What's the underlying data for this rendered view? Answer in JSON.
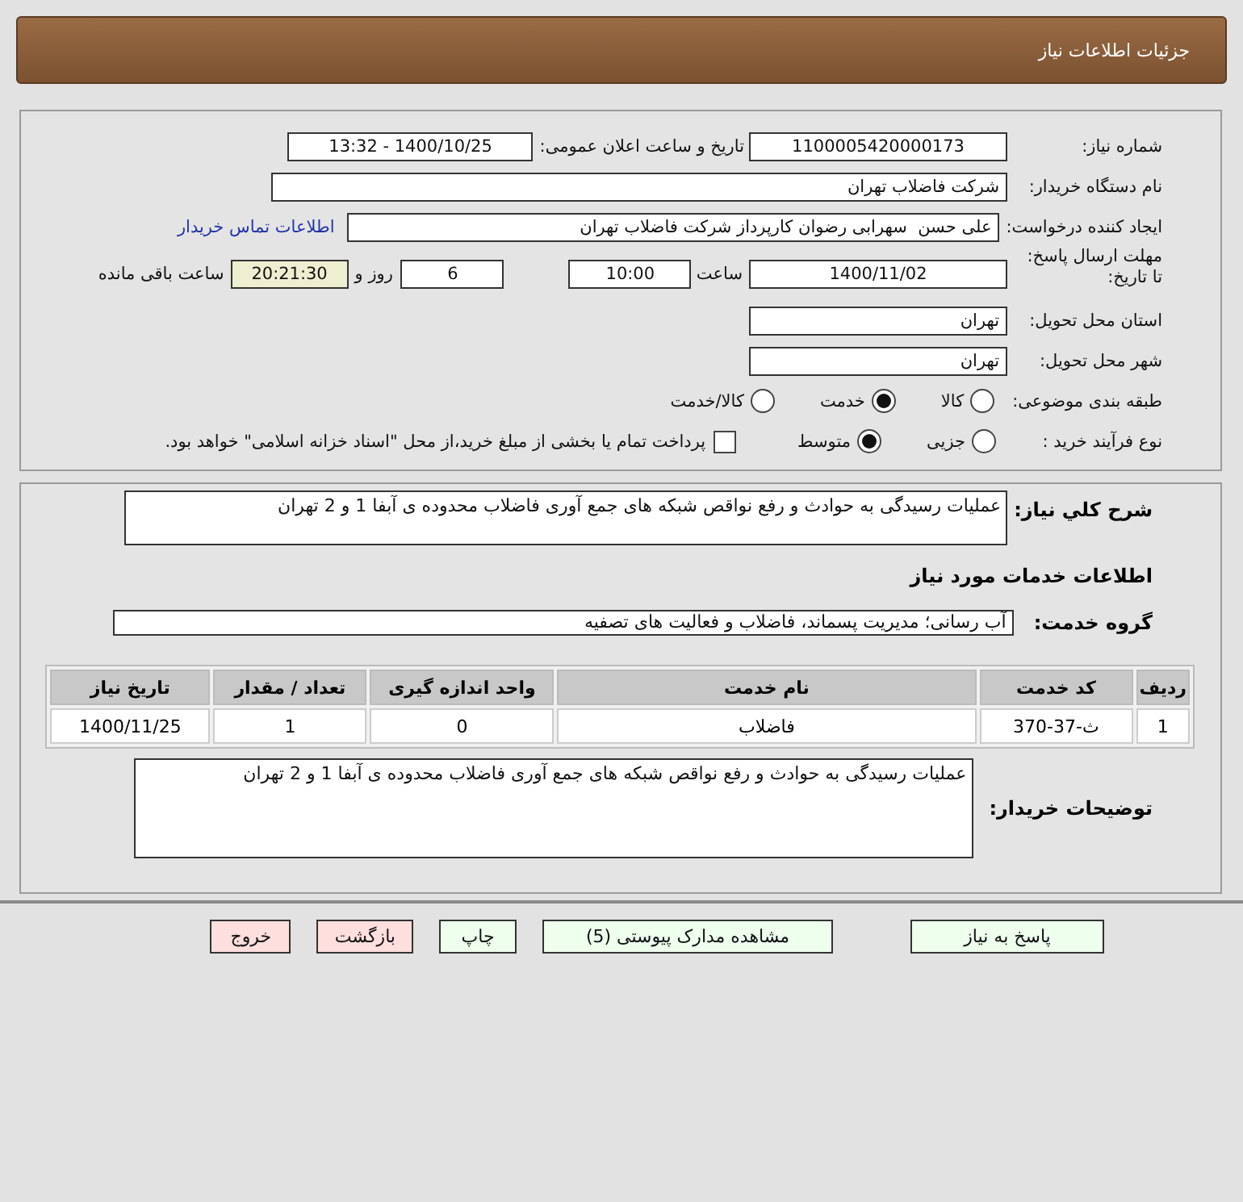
{
  "header": {
    "title": "جزئیات اطلاعات نیاز"
  },
  "details": {
    "need_number": {
      "label": "شماره نیاز:",
      "value": "1100005420000173"
    },
    "announce": {
      "label": "تاریخ و ساعت اعلان عمومی:",
      "value": "1400/10/25 - 13:32"
    },
    "buyer_org": {
      "label": "نام دستگاه خریدار:",
      "value": "شرکت فاضلاب تهران"
    },
    "requester": {
      "label": "ایجاد کننده درخواست:",
      "value": "علی حسن  سهرابی رضوان کارپرداز شرکت فاضلاب تهران",
      "link": "اطلاعات تماس خریدار"
    },
    "deadline": {
      "label": "مهلت ارسال پاسخ: تا تاریخ:",
      "date": "1400/11/02",
      "time_label": "ساعت",
      "time": "10:00",
      "days": "6",
      "days_label": "روز و",
      "remaining": "20:21:30",
      "remaining_label": "ساعت باقی مانده"
    },
    "province": {
      "label": "استان محل تحویل:",
      "value": "تهران"
    },
    "city": {
      "label": "شهر محل تحویل:",
      "value": "تهران"
    },
    "category": {
      "label": "طبقه بندی موضوعی:",
      "options": [
        {
          "label": "کالا",
          "selected": false
        },
        {
          "label": "خدمت",
          "selected": true
        },
        {
          "label": "کالا/خدمت",
          "selected": false
        }
      ]
    },
    "process": {
      "label": "نوع فرآیند خرید :",
      "options": [
        {
          "label": "جزیی",
          "selected": false
        },
        {
          "label": "متوسط",
          "selected": true
        }
      ],
      "treasury": {
        "checked": false,
        "text": "پرداخت تمام یا بخشی از مبلغ خرید،از محل \"اسناد خزانه اسلامی\" خواهد بود."
      }
    }
  },
  "service": {
    "summary": {
      "label": "شرح کلي نياز:",
      "value": "عملیات رسیدگی به حوادث و رفع نواقص شبکه های جمع آوری فاضلاب محدوده ی آبفا 1 و 2 تهران"
    },
    "heading": "اطلاعات خدمات مورد نیاز",
    "group": {
      "label": "گروه خدمت:",
      "value": "آب رسانی؛ مدیریت پسماند، فاضلاب و فعالیت های تصفیه"
    },
    "table": {
      "columns": [
        "ردیف",
        "کد خدمت",
        "نام خدمت",
        "واحد اندازه گیری",
        "تعداد / مقدار",
        "تاریخ نیاز"
      ],
      "rows": [
        [
          "1",
          "ث-37-370",
          "فاضلاب",
          "0",
          "1",
          "1400/11/25"
        ]
      ]
    },
    "notes": {
      "label": "توضیحات خریدار:",
      "value": "عملیات رسیدگی به حوادث و رفع نواقص شبکه های جمع آوری فاضلاب محدوده ی آبفا 1 و 2 تهران"
    }
  },
  "buttons": [
    {
      "label": "پاسخ به نیاز",
      "kind": "action"
    },
    {
      "label": "مشاهده مدارک پیوستی (5)",
      "kind": "action"
    },
    {
      "label": "چاپ",
      "kind": "action"
    },
    {
      "label": "بازگشت",
      "kind": "exit"
    },
    {
      "label": "خروج",
      "kind": "exit"
    }
  ]
}
